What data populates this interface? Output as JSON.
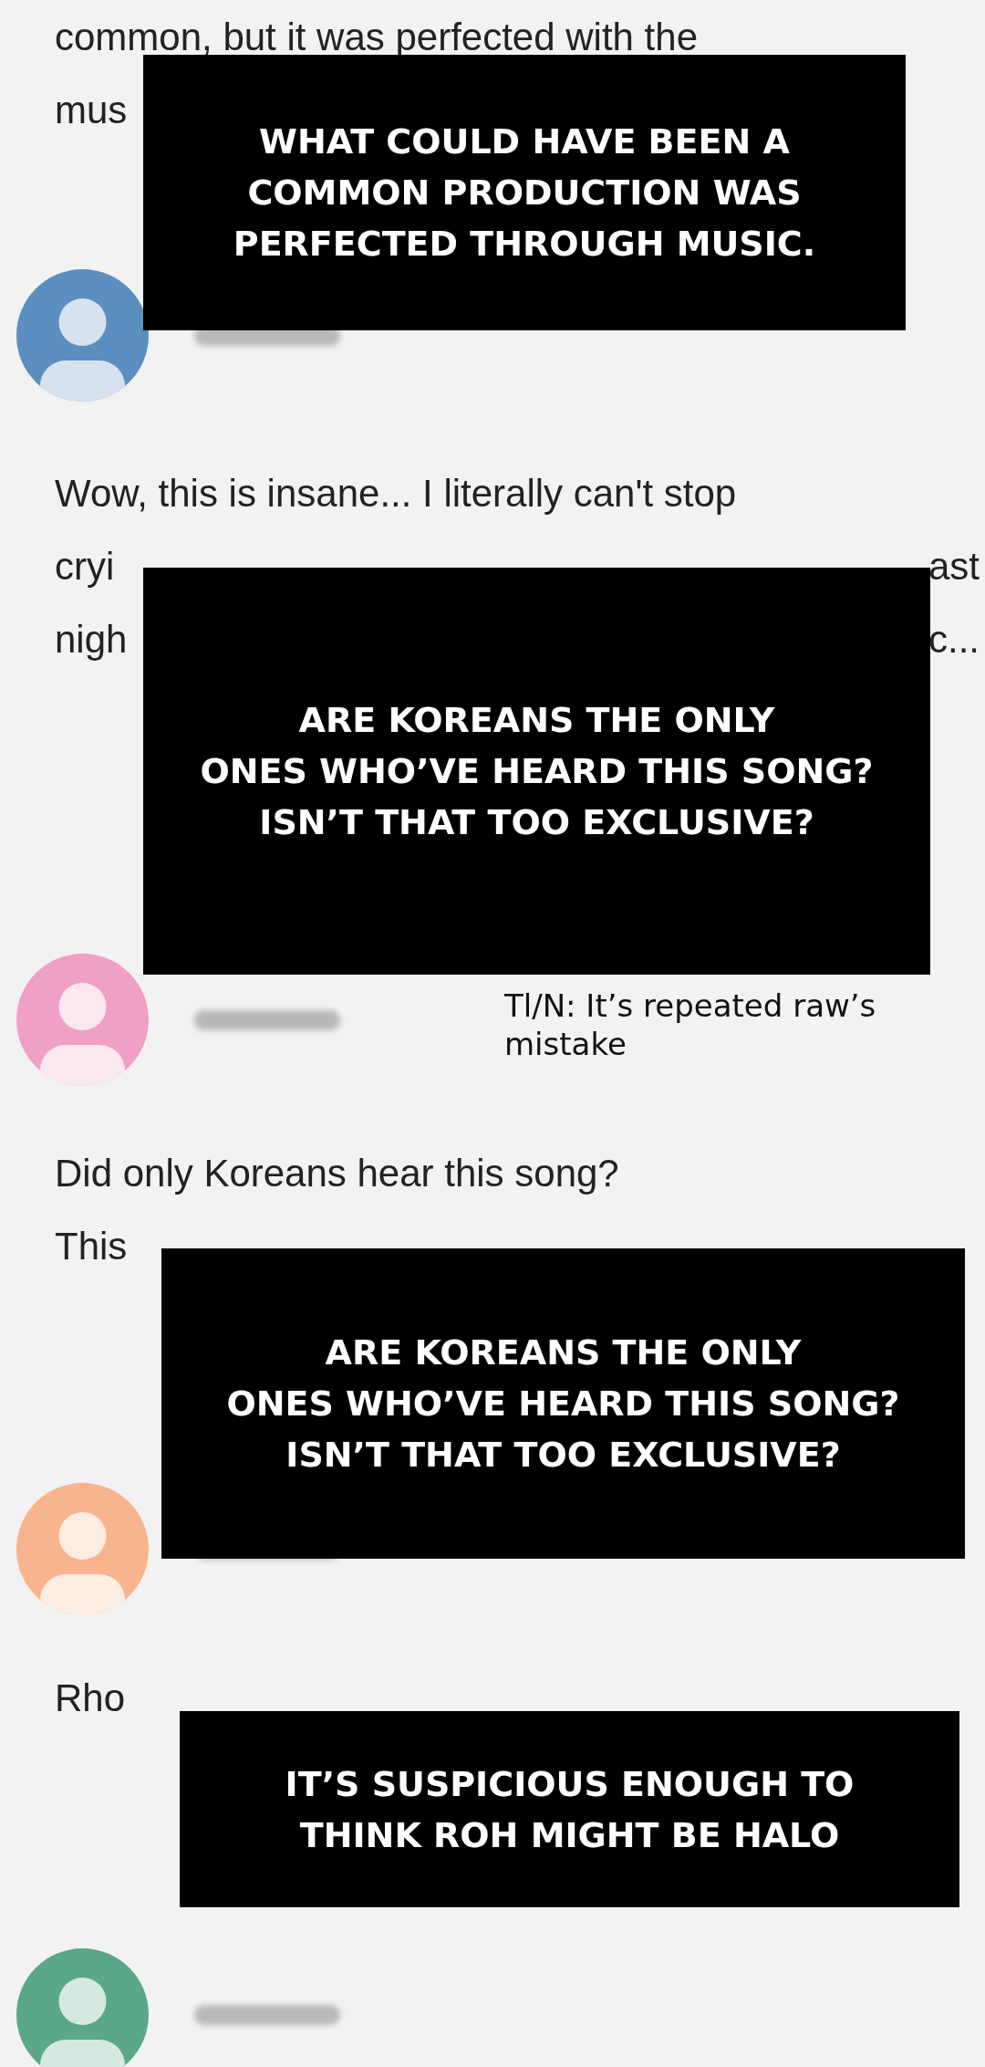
{
  "comments": [
    {
      "lines": [
        {
          "left": "common, but it was perfected with the"
        },
        {
          "left": "mus"
        }
      ],
      "color": "#5b8fc0",
      "translation": [
        "WHAT COULD HAVE BEEN A",
        "COMMON PRODUCTION WAS",
        "PERFECTED THROUGH MUSIC."
      ]
    },
    {
      "lines": [
        {
          "left": "Wow, this is insane... I literally can't stop"
        },
        {
          "left": "cryi",
          "right": "ast"
        },
        {
          "left": "nigh",
          "right": "c..."
        }
      ],
      "color": "#f0a0c4",
      "translation": [
        "ARE KOREANS THE ONLY",
        "ONES WHO’VE HEARD THIS SONG?",
        "ISN’T THAT TOO EXCLUSIVE?"
      ],
      "note": "Tl/N: It’s repeated raw’s mistake"
    },
    {
      "lines": [
        {
          "left": "Did only Koreans hear this song?"
        },
        {
          "left": "This"
        }
      ],
      "color": "#f8b48c",
      "translation": [
        "ARE KOREANS THE ONLY",
        "ONES WHO’VE HEARD THIS SONG?",
        "ISN’T THAT TOO EXCLUSIVE?"
      ]
    },
    {
      "lines": [
        {
          "left": "Rho"
        }
      ],
      "color": "#5aa888",
      "translation": [
        "IT’S SUSPICIOUS ENOUGH TO",
        "THINK ROH MIGHT BE HALO"
      ]
    }
  ]
}
